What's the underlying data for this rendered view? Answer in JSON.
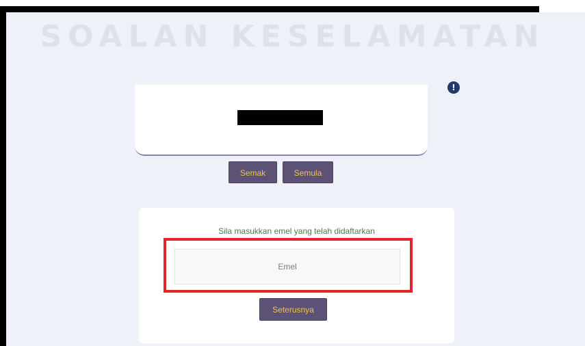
{
  "header": {
    "title": "SOALAN KESELAMATAN"
  },
  "captcha": {
    "check_label": "Semak",
    "reset_label": "Semula"
  },
  "email_form": {
    "instruction": "Sila masukkan emel yang telah didaftarkan",
    "email_placeholder": "Emel",
    "email_value": "",
    "next_label": "Seterusnya"
  },
  "icons": {
    "alert": "exclamation-circle-icon"
  },
  "colors": {
    "button_bg": "#5c5275",
    "button_text": "#f3c24a",
    "highlight": "#e32329",
    "instruction_text": "#4c7a4c",
    "alert_icon": "#1f3a6b"
  }
}
